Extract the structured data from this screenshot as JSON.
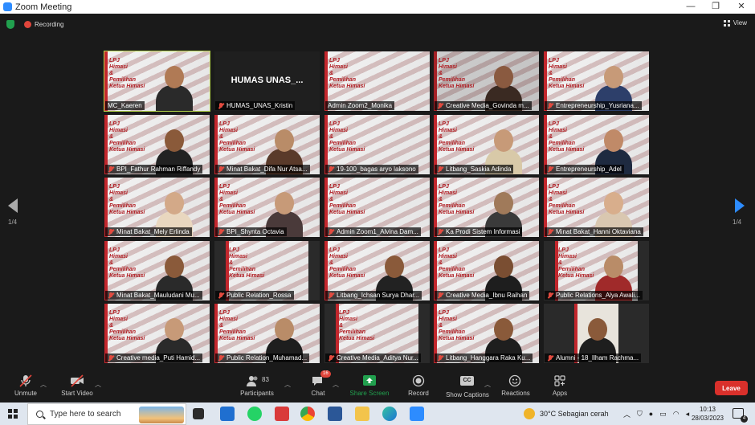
{
  "window": {
    "title": "Zoom Meeting",
    "minimize": "—",
    "maximize": "❐",
    "close": "✕"
  },
  "topbar": {
    "recording_label": "Recording",
    "view_label": "View"
  },
  "paging": {
    "prev_page": "1/4",
    "next_page": "1/4"
  },
  "tiles": [
    {
      "name": "MC_Kaeren",
      "muted": false,
      "kind": "poster",
      "active": true,
      "skin": "#b07a55",
      "shirt": "#2a2a2a"
    },
    {
      "name": "HUMAS_UNAS_Kristin",
      "muted": true,
      "kind": "blank",
      "big": "HUMAS  UNAS_..."
    },
    {
      "name": "Admin Zoom2_Monika",
      "muted": false,
      "kind": "poster"
    },
    {
      "name": "Creative Media_Govinda m...",
      "muted": true,
      "kind": "poster-dark",
      "skin": "#8a5a40",
      "shirt": "#3a2a22"
    },
    {
      "name": "Entrepreneurship_Yusriana...",
      "muted": true,
      "kind": "poster",
      "skin": "#c79a78",
      "shirt": "#2d3f6a"
    },
    {
      "name": "BPI_Fathur Rahman Riffandy",
      "muted": true,
      "kind": "poster",
      "skin": "#8a5a3a",
      "shirt": "#222222"
    },
    {
      "name": "Minat Bakat_Difa Nur Atsa...",
      "muted": true,
      "kind": "poster",
      "skin": "#b98c68",
      "shirt": "#5a3a2a"
    },
    {
      "name": "19-100_bagas aryo laksono",
      "muted": true,
      "kind": "poster"
    },
    {
      "name": "Litbang_Saskia Adinda",
      "muted": true,
      "kind": "poster",
      "skin": "#c79a78",
      "shirt": "#d8c9a8"
    },
    {
      "name": "Entrepreneurship_Adel",
      "muted": true,
      "kind": "poster",
      "skin": "#c08a68",
      "shirt": "#1e2a40"
    },
    {
      "name": "Minat Bakat_Mely Erlinda",
      "muted": true,
      "kind": "poster",
      "skin": "#d3a988",
      "shirt": "#e9d7bf"
    },
    {
      "name": "BPI_Shynta Octavia",
      "muted": true,
      "kind": "poster",
      "skin": "#c79a78",
      "shirt": "#4a3a3a"
    },
    {
      "name": "Admin Zoom1_Alvina Dam...",
      "muted": true,
      "kind": "poster"
    },
    {
      "name": "Ka Prodi Sistem Informasi",
      "muted": true,
      "kind": "poster",
      "skin": "#a07a5a",
      "shirt": "#3a3a3a"
    },
    {
      "name": "Minat Bakat_Hanni Oktaviana",
      "muted": true,
      "kind": "poster",
      "skin": "#d8ae8c",
      "shirt": "#d9c7b0"
    },
    {
      "name": "Minat Bakat_Mauludani Mu...",
      "muted": true,
      "kind": "poster",
      "skin": "#8a5a3a",
      "shirt": "#2a2a2a"
    },
    {
      "name": "Public Relation_Rossa",
      "muted": true,
      "kind": "poster-inset"
    },
    {
      "name": "Litbang_Ichsan Surya Dhar...",
      "muted": true,
      "kind": "poster",
      "skin": "#8a5a3a",
      "shirt": "#222222"
    },
    {
      "name": "Creative Media_Ibnu Raihan",
      "muted": true,
      "kind": "poster",
      "skin": "#7a4e32",
      "shirt": "#1e1e1e"
    },
    {
      "name": "Public Relations_Alya Awali...",
      "muted": true,
      "kind": "poster-inset",
      "skin": "#b98c68",
      "shirt": "#a02a2a"
    },
    {
      "name": "Creative media_Puti Hamid...",
      "muted": true,
      "kind": "poster",
      "skin": "#c79a78",
      "shirt": "#2a2a2a"
    },
    {
      "name": "Public Relation_Muhamad...",
      "muted": true,
      "kind": "poster",
      "skin": "#b98c68",
      "shirt": "#1e1e1e"
    },
    {
      "name": "Creative Media_Aditya Nur...",
      "muted": true,
      "kind": "poster-inset"
    },
    {
      "name": "Litbang_Hanggara Raka Ku...",
      "muted": true,
      "kind": "poster",
      "skin": "#8a5a3a",
      "shirt": "#1e1e1e"
    },
    {
      "name": "Alumni - 18_Ilham Rachma...",
      "muted": true,
      "kind": "room",
      "skin": "#8a5a3a",
      "shirt": "#1e1e1e"
    }
  ],
  "poster_text": "LPJ\nHimasi\n&\nPemilihan\nKetua Himasi",
  "toolbar": {
    "unmute": "Unmute",
    "start_video": "Start Video",
    "participants": "Participants",
    "participant_count": "83",
    "chat": "Chat",
    "chat_badge": "16",
    "share_screen": "Share Screen",
    "record": "Record",
    "show_captions": "Show Captions",
    "reactions": "Reactions",
    "apps": "Apps",
    "leave": "Leave",
    "captions_icon_text": "CC"
  },
  "taskbar": {
    "search_placeholder": "Type here to search",
    "weather": "30°C  Sebagian cerah",
    "time": "10:13",
    "date": "28/03/2023",
    "notification_count": "4"
  },
  "colors": {
    "accent_green": "#21a04e",
    "leave_red": "#d9302b",
    "active_border": "#b8d94a",
    "nav_blue": "#2d8cff"
  }
}
